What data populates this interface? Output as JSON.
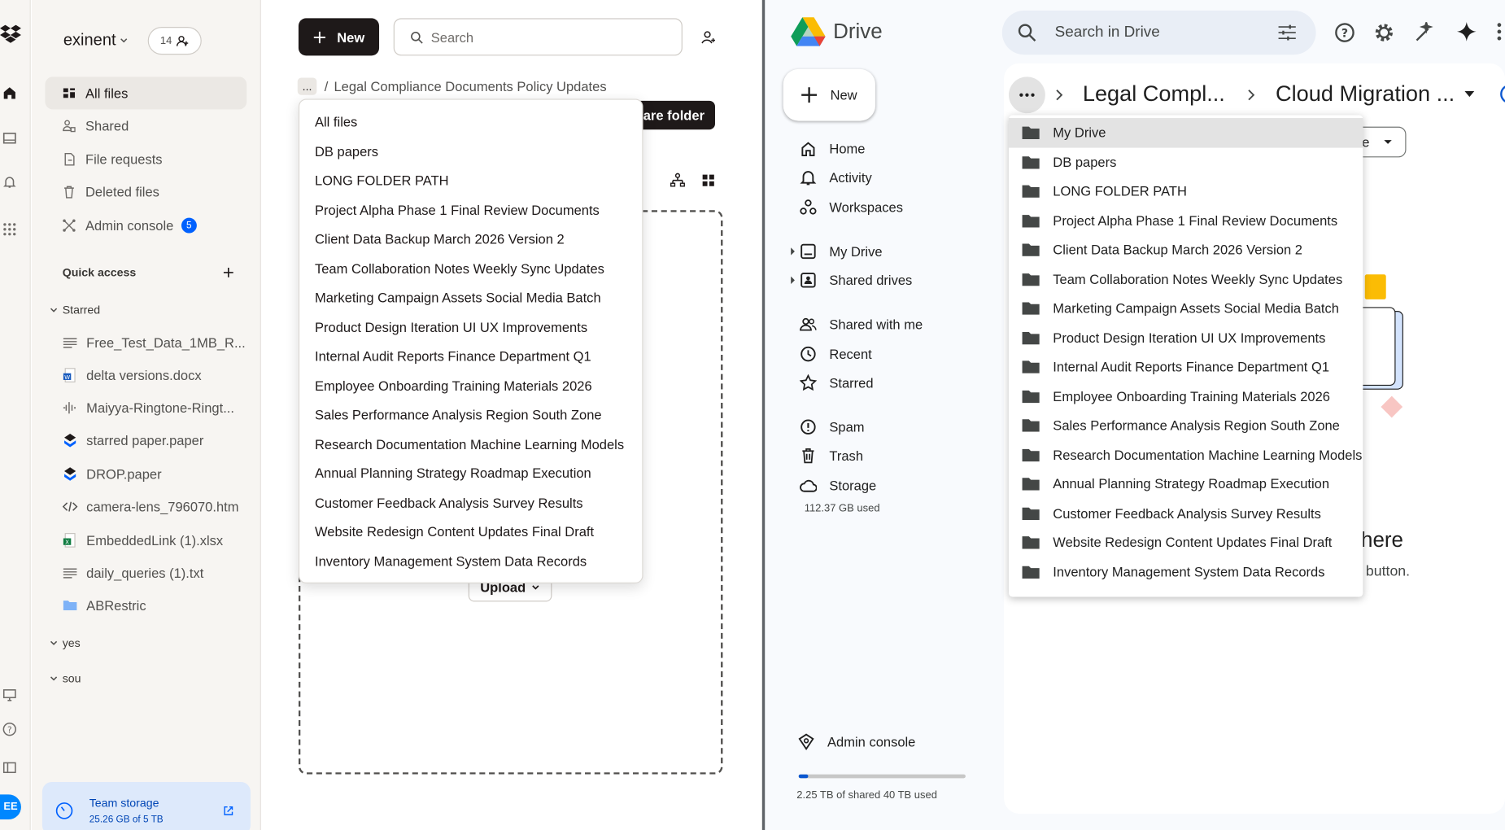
{
  "dropbox": {
    "account": {
      "name": "exinent",
      "members_count": "14"
    },
    "nav": [
      {
        "label": "All files",
        "icon": "all-files-icon"
      },
      {
        "label": "Shared",
        "icon": "shared-icon"
      },
      {
        "label": "File requests",
        "icon": "file-requests-icon"
      },
      {
        "label": "Deleted files",
        "icon": "trash-icon"
      },
      {
        "label": "Admin console",
        "icon": "admin-icon",
        "badge": "5"
      }
    ],
    "quick_access_label": "Quick access",
    "starred_label": "Starred",
    "starred": [
      {
        "label": "Free_Test_Data_1MB_R...",
        "icon": "text-file-icon"
      },
      {
        "label": "delta versions.docx",
        "icon": "word-file-icon"
      },
      {
        "label": "Maiyya-Ringtone-Ringt...",
        "icon": "audio-file-icon"
      },
      {
        "label": "starred paper.paper",
        "icon": "paper-icon"
      },
      {
        "label": "DROP.paper",
        "icon": "paper-icon"
      },
      {
        "label": "camera-lens_796070.htm",
        "icon": "code-file-icon"
      },
      {
        "label": "EmbeddedLink (1).xlsx",
        "icon": "excel-file-icon"
      },
      {
        "label": "daily_queries (1).txt",
        "icon": "text-file-icon"
      },
      {
        "label": "ABRestric",
        "icon": "folder-icon"
      }
    ],
    "groups": [
      "yes",
      "sou"
    ],
    "storage": {
      "title": "Team storage",
      "usage": "25.26 GB of 5 TB"
    },
    "avatar_initials": "EE",
    "new_label": "New",
    "search_placeholder": "Search",
    "breadcrumb_more": "...",
    "breadcrumb_separator": "/",
    "breadcrumb_current": "Legal Compliance Documents Policy Updates",
    "share_folder_label": "are folder",
    "upload_label": "Upload",
    "dropdown_items": [
      "All files",
      "DB papers",
      "LONG FOLDER PATH",
      "Project Alpha Phase 1 Final Review Documents",
      "Client Data Backup March 2026 Version 2",
      "Team Collaboration Notes Weekly Sync Updates",
      "Marketing Campaign Assets Social Media Batch",
      "Product Design Iteration UI UX Improvements",
      "Internal Audit Reports Finance Department Q1",
      "Employee Onboarding Training Materials 2026",
      "Sales Performance Analysis Region South Zone",
      "Research Documentation Machine Learning Models",
      "Annual Planning Strategy Roadmap Execution",
      "Customer Feedback Analysis Survey Results",
      "Website Redesign Content Updates Final Draft",
      "Inventory Management System Data Records"
    ]
  },
  "gdrive": {
    "app_name": "Drive",
    "search_placeholder": "Search in Drive",
    "new_label": "New",
    "nav": [
      {
        "label": "Home",
        "icon": "home-icon"
      },
      {
        "label": "Activity",
        "icon": "bell-icon"
      },
      {
        "label": "Workspaces",
        "icon": "workspaces-icon"
      },
      {
        "label": "My Drive",
        "icon": "my-drive-icon"
      },
      {
        "label": "Shared drives",
        "icon": "shared-drives-icon"
      },
      {
        "label": "Shared with me",
        "icon": "people-icon"
      },
      {
        "label": "Recent",
        "icon": "clock-icon"
      },
      {
        "label": "Starred",
        "icon": "star-icon"
      },
      {
        "label": "Spam",
        "icon": "spam-icon"
      },
      {
        "label": "Trash",
        "icon": "trash-icon"
      },
      {
        "label": "Storage",
        "icon": "cloud-icon"
      }
    ],
    "storage_used": "112.37 GB used",
    "admin_console_label": "Admin console",
    "shared_storage": {
      "text": "2.25 TB of shared 40 TB used",
      "fraction": 0.056
    },
    "breadcrumb": {
      "middle": "Legal Compl...",
      "current": "Cloud Migration ..."
    },
    "type_filter_fragment": "e",
    "empty_state": {
      "title_fragment": "here",
      "text_fragment": "button."
    },
    "dropdown_items": [
      "My Drive",
      "DB papers",
      "LONG FOLDER PATH",
      "Project Alpha Phase 1 Final Review Documents",
      "Client Data Backup March 2026 Version 2",
      "Team Collaboration Notes Weekly Sync Updates",
      "Marketing Campaign Assets Social Media Batch",
      "Product Design Iteration UI UX Improvements",
      "Internal Audit Reports Finance Department Q1",
      "Employee Onboarding Training Materials 2026",
      "Sales Performance Analysis Region South Zone",
      "Research Documentation Machine Learning Models",
      "Annual Planning Strategy Roadmap Execution",
      "Customer Feedback Analysis Survey Results",
      "Website Redesign Content Updates Final Draft",
      "Inventory Management System Data Records"
    ]
  },
  "colors": {
    "dropbox_accent": "#0061fe",
    "drive_blue": "#0b57d0",
    "share_button": "#1e1919"
  }
}
